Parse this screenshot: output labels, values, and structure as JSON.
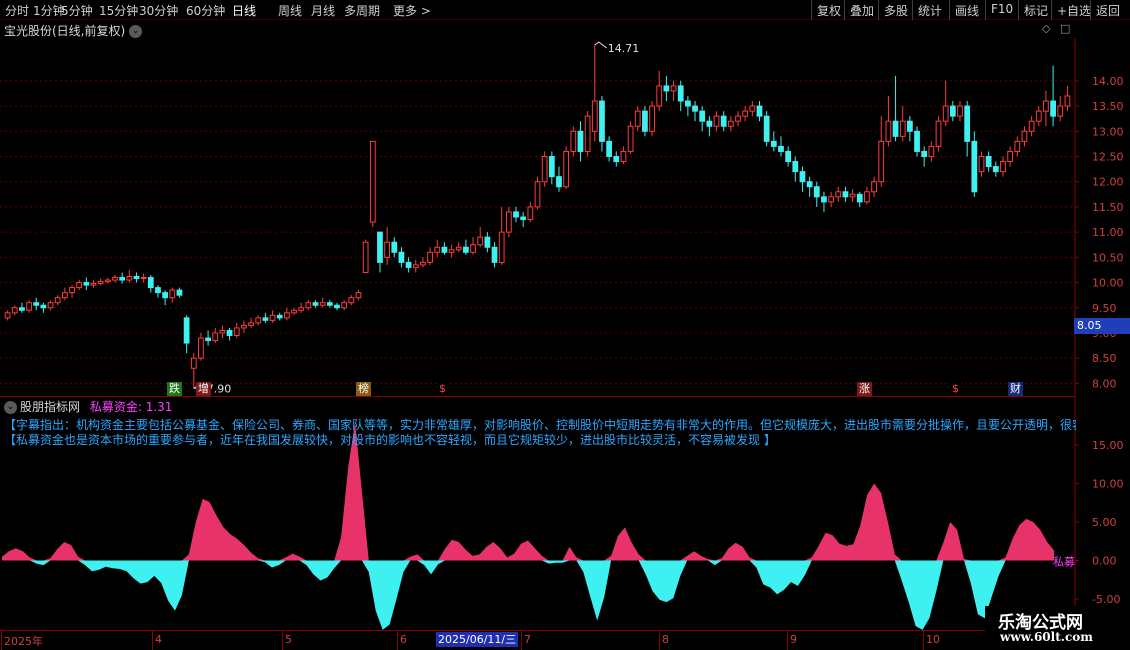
{
  "toolbar": {
    "periods": [
      "分时",
      "1分钟",
      "5分钟",
      "15分钟",
      "30分钟",
      "60分钟",
      "日线",
      "周线",
      "月线",
      "多周期",
      "更多 >"
    ],
    "active_period": "日线",
    "actions": [
      "复权",
      "叠加",
      "多股",
      "统计",
      "画线",
      "F10",
      "标记",
      "+自选",
      "返回"
    ]
  },
  "main_chart": {
    "title": "宝光股份(日线,前复权)",
    "high_marker": "14.71",
    "low_marker": "7.90",
    "current_price": "8.05",
    "y_ticks": [
      "14.00",
      "13.50",
      "13.00",
      "12.50",
      "12.00",
      "11.50",
      "11.00",
      "10.50",
      "10.00",
      "9.50",
      "9.00",
      "8.50",
      "8.00"
    ],
    "event_tags": [
      {
        "text": "跌",
        "color": "#1a7a1a"
      },
      {
        "text": "增",
        "color": "#7a1a1a"
      },
      {
        "text": "榜",
        "color": "#8a5a10"
      },
      {
        "text": "$",
        "color": "#000000"
      },
      {
        "text": "涨",
        "color": "#7a1a1a"
      },
      {
        "text": "$",
        "color": "#000000"
      },
      {
        "text": "财",
        "color": "#1a2a7a"
      }
    ]
  },
  "indicator": {
    "site": "股朋指标网",
    "name_label": "私募资金:",
    "value": "1.31",
    "description_lines": [
      "【字幕指出：机构资金主要包括公募基金、保险公司、券商、国家队等等，实力非常雄厚，对影响股价、控制股价中短期走势有非常大的作用。但它规模庞大，进出股市需要分批操作，且要公开透明，很容",
      "【私募资金也是资本市场的重要参与者，近年在我国发展较快，对股市的影响也不容轻视，而且它规矩较少，进出股市比较灵活，不容易被发现 】"
    ],
    "series_label": "私募",
    "y_ticks": [
      "15.00",
      "10.00",
      "5.00",
      "0.00",
      "-5.00"
    ]
  },
  "chart_data": {
    "type": "area",
    "title": "",
    "xlabel": "",
    "ylabel": "",
    "ylim": [
      -8,
      20
    ],
    "x": [
      1,
      2,
      3,
      4,
      5,
      6,
      7,
      8,
      9,
      10,
      11,
      12,
      13,
      14,
      15,
      16,
      17,
      18,
      19,
      20,
      21,
      22,
      23,
      24,
      25,
      26,
      27,
      28,
      29,
      30,
      31,
      32,
      33,
      34,
      35,
      36,
      37,
      38,
      39,
      40,
      41,
      42,
      43,
      44,
      45,
      46,
      47,
      48,
      49,
      50,
      51,
      52,
      53,
      54,
      55,
      56,
      57,
      58,
      59,
      60,
      61,
      62,
      63,
      64,
      65,
      66,
      67,
      68,
      69,
      70,
      71,
      72,
      73,
      74,
      75,
      76,
      77,
      78,
      79,
      80,
      81,
      82,
      83,
      84,
      85,
      86,
      87,
      88,
      89,
      90,
      91,
      92,
      93,
      94,
      95,
      96,
      97,
      98,
      99,
      100,
      101,
      102,
      103,
      104,
      105,
      106,
      107,
      108,
      109,
      110,
      111,
      112,
      113,
      114,
      115,
      116,
      117,
      118,
      119,
      120,
      121,
      122,
      123,
      124,
      125,
      126,
      127,
      128,
      129,
      130,
      131,
      132,
      133,
      134,
      135,
      136,
      137,
      138,
      139,
      140,
      141,
      142,
      143,
      144,
      145,
      146,
      147,
      148,
      149,
      150,
      151,
      152,
      153,
      154,
      155,
      156,
      157,
      158,
      159,
      160,
      161,
      162,
      163,
      164,
      165,
      166,
      167,
      168,
      169,
      170,
      171,
      172,
      173,
      174,
      175
    ],
    "series": [
      {
        "name": "私募",
        "color_positive": "#e8336a",
        "color_negative": "#3ff0f0",
        "values": [
          0.5,
          1.2,
          1.6,
          1.2,
          0.4,
          -0.4,
          -0.6,
          0.3,
          1.5,
          2.4,
          2.0,
          0.5,
          -0.6,
          -1.4,
          -1.2,
          -0.8,
          -1.0,
          -1.1,
          -1.4,
          -2.3,
          -3.0,
          -2.8,
          -2.0,
          -2.9,
          -5.2,
          -6.5,
          -4.5,
          0.8,
          5.0,
          8.0,
          7.6,
          5.8,
          4.3,
          3.4,
          2.8,
          2.0,
          1.0,
          0.3,
          -0.2,
          -0.9,
          -0.6,
          0.4,
          0.9,
          0.5,
          -0.6,
          -1.8,
          -2.6,
          -2.2,
          -1.0,
          3.0,
          12.0,
          18.0,
          9.0,
          -1.5,
          -6.5,
          -9.0,
          -8.3,
          -5.0,
          -1.5,
          0.5,
          0.8,
          -0.6,
          -1.8,
          -0.5,
          1.5,
          2.7,
          2.4,
          1.4,
          0.6,
          0.8,
          1.8,
          2.4,
          1.6,
          0.4,
          0.9,
          2.2,
          2.6,
          1.6,
          0.6,
          -0.4,
          -0.3,
          -0.3,
          1.8,
          0.4,
          -1.5,
          -4.7,
          -7.8,
          -4.8,
          0.6,
          3.2,
          4.3,
          2.3,
          0.8,
          -1.8,
          -4.0,
          -5.1,
          -5.4,
          -4.9,
          -2.0,
          0.6,
          1.2,
          0.6,
          0.2,
          -0.6,
          0.3,
          1.6,
          2.3,
          1.8,
          0.4,
          -0.9,
          -3.1,
          -3.5,
          -4.4,
          -3.8,
          -2.8,
          -3.3,
          -1.9,
          0.4,
          1.9,
          3.6,
          3.3,
          2.2,
          1.9,
          2.1,
          4.5,
          8.5,
          10.0,
          8.8,
          5.0,
          0.8,
          -2.6,
          -5.4,
          -8.5,
          -9.0,
          -7.5,
          -4.0,
          2.3,
          5.0,
          4.0,
          0.2,
          -3.0,
          -7.0,
          -7.5,
          -4.7,
          -2.0,
          0.4,
          2.8,
          4.6,
          5.4,
          5.0,
          4.0,
          2.4,
          1.31
        ]
      }
    ]
  },
  "price_data": {
    "high_marker_index": 82,
    "low_marker_index": 26,
    "candles": [
      [
        9.3,
        9.4,
        9.25,
        9.45
      ],
      [
        9.4,
        9.5,
        9.35,
        9.55
      ],
      [
        9.5,
        9.45,
        9.4,
        9.6
      ],
      [
        9.45,
        9.6,
        9.4,
        9.65
      ],
      [
        9.6,
        9.55,
        9.45,
        9.7
      ],
      [
        9.55,
        9.5,
        9.4,
        9.6
      ],
      [
        9.5,
        9.6,
        9.45,
        9.65
      ],
      [
        9.6,
        9.7,
        9.55,
        9.75
      ],
      [
        9.7,
        9.8,
        9.65,
        9.9
      ],
      [
        9.8,
        9.9,
        9.7,
        9.95
      ],
      [
        9.9,
        10.0,
        9.85,
        10.05
      ],
      [
        10.0,
        9.95,
        9.85,
        10.1
      ],
      [
        9.95,
        9.98,
        9.9,
        10.05
      ],
      [
        9.98,
        10.02,
        9.95,
        10.08
      ],
      [
        10.02,
        10.05,
        9.98,
        10.1
      ],
      [
        10.05,
        10.1,
        10.0,
        10.15
      ],
      [
        10.1,
        10.05,
        9.98,
        10.2
      ],
      [
        10.05,
        10.12,
        10.0,
        10.25
      ],
      [
        10.12,
        10.08,
        10.0,
        10.2
      ],
      [
        10.08,
        10.1,
        10.0,
        10.18
      ],
      [
        10.1,
        9.9,
        9.8,
        10.15
      ],
      [
        9.9,
        9.8,
        9.7,
        9.95
      ],
      [
        9.8,
        9.7,
        9.55,
        9.85
      ],
      [
        9.7,
        9.85,
        9.6,
        9.9
      ],
      [
        9.85,
        9.75,
        9.7,
        9.9
      ],
      [
        9.3,
        8.8,
        8.6,
        9.35
      ],
      [
        8.3,
        8.5,
        7.9,
        8.6
      ],
      [
        8.5,
        8.9,
        8.45,
        9.0
      ],
      [
        8.9,
        8.85,
        8.75,
        9.05
      ],
      [
        8.85,
        9.0,
        8.8,
        9.1
      ],
      [
        9.0,
        9.05,
        8.9,
        9.15
      ],
      [
        9.05,
        8.95,
        8.85,
        9.1
      ],
      [
        8.95,
        9.1,
        8.9,
        9.2
      ],
      [
        9.1,
        9.15,
        9.0,
        9.25
      ],
      [
        9.15,
        9.2,
        9.1,
        9.3
      ],
      [
        9.2,
        9.3,
        9.15,
        9.35
      ],
      [
        9.3,
        9.25,
        9.2,
        9.4
      ],
      [
        9.25,
        9.35,
        9.2,
        9.45
      ],
      [
        9.35,
        9.3,
        9.25,
        9.4
      ],
      [
        9.3,
        9.4,
        9.25,
        9.5
      ],
      [
        9.4,
        9.45,
        9.35,
        9.5
      ],
      [
        9.45,
        9.5,
        9.4,
        9.6
      ],
      [
        9.5,
        9.6,
        9.45,
        9.65
      ],
      [
        9.6,
        9.55,
        9.5,
        9.65
      ],
      [
        9.55,
        9.6,
        9.5,
        9.7
      ],
      [
        9.6,
        9.55,
        9.5,
        9.65
      ],
      [
        9.55,
        9.5,
        9.45,
        9.6
      ],
      [
        9.5,
        9.6,
        9.45,
        9.65
      ],
      [
        9.6,
        9.7,
        9.55,
        9.75
      ],
      [
        9.7,
        9.8,
        9.65,
        9.85
      ],
      [
        10.2,
        10.8,
        10.2,
        10.85
      ],
      [
        11.2,
        12.8,
        11.1,
        12.8
      ],
      [
        11.0,
        10.4,
        10.2,
        11.0
      ],
      [
        10.5,
        10.8,
        10.35,
        11.1
      ],
      [
        10.8,
        10.6,
        10.5,
        10.9
      ],
      [
        10.6,
        10.4,
        10.3,
        10.7
      ],
      [
        10.4,
        10.3,
        10.2,
        10.5
      ],
      [
        10.3,
        10.35,
        10.2,
        10.45
      ],
      [
        10.35,
        10.4,
        10.3,
        10.5
      ],
      [
        10.4,
        10.6,
        10.35,
        10.7
      ],
      [
        10.6,
        10.7,
        10.5,
        10.85
      ],
      [
        10.7,
        10.6,
        10.55,
        10.8
      ],
      [
        10.6,
        10.65,
        10.5,
        10.75
      ],
      [
        10.65,
        10.7,
        10.6,
        10.8
      ],
      [
        10.7,
        10.6,
        10.55,
        10.85
      ],
      [
        10.6,
        10.75,
        10.55,
        10.9
      ],
      [
        10.75,
        10.9,
        10.7,
        11.1
      ],
      [
        10.9,
        10.7,
        10.6,
        11.0
      ],
      [
        10.7,
        10.4,
        10.3,
        10.8
      ],
      [
        10.4,
        11.0,
        10.35,
        11.5
      ],
      [
        11.0,
        11.4,
        10.9,
        11.5
      ],
      [
        11.4,
        11.3,
        11.2,
        11.5
      ],
      [
        11.3,
        11.25,
        11.1,
        11.4
      ],
      [
        11.25,
        11.5,
        11.2,
        11.6
      ],
      [
        11.5,
        12.0,
        11.45,
        12.1
      ],
      [
        12.0,
        12.5,
        11.9,
        12.6
      ],
      [
        12.5,
        12.1,
        11.95,
        12.6
      ],
      [
        12.1,
        11.9,
        11.8,
        12.3
      ],
      [
        11.9,
        12.6,
        11.85,
        12.7
      ],
      [
        12.6,
        13.0,
        12.5,
        13.1
      ],
      [
        13.0,
        12.6,
        12.4,
        13.2
      ],
      [
        12.6,
        13.3,
        12.5,
        13.4
      ],
      [
        13.0,
        13.6,
        12.8,
        14.71
      ],
      [
        13.6,
        12.8,
        12.6,
        13.7
      ],
      [
        12.8,
        12.5,
        12.4,
        12.9
      ],
      [
        12.5,
        12.4,
        12.3,
        12.6
      ],
      [
        12.4,
        12.6,
        12.35,
        12.7
      ],
      [
        12.6,
        13.1,
        12.55,
        13.2
      ],
      [
        13.1,
        13.4,
        13.0,
        13.5
      ],
      [
        13.4,
        13.0,
        12.9,
        13.5
      ],
      [
        13.0,
        13.5,
        12.9,
        13.6
      ],
      [
        13.5,
        13.9,
        13.4,
        14.2
      ],
      [
        13.9,
        13.8,
        13.6,
        14.1
      ],
      [
        13.8,
        13.9,
        13.6,
        14.0
      ],
      [
        13.9,
        13.6,
        13.4,
        14.0
      ],
      [
        13.6,
        13.5,
        13.3,
        13.7
      ],
      [
        13.5,
        13.4,
        13.2,
        13.6
      ],
      [
        13.4,
        13.2,
        13.0,
        13.5
      ],
      [
        13.2,
        13.1,
        12.9,
        13.3
      ],
      [
        13.1,
        13.3,
        13.0,
        13.4
      ],
      [
        13.3,
        13.1,
        13.0,
        13.4
      ],
      [
        13.1,
        13.2,
        13.0,
        13.3
      ],
      [
        13.2,
        13.3,
        13.1,
        13.4
      ],
      [
        13.3,
        13.4,
        13.2,
        13.5
      ],
      [
        13.4,
        13.5,
        13.3,
        13.6
      ],
      [
        13.5,
        13.3,
        13.2,
        13.6
      ],
      [
        13.3,
        12.8,
        12.7,
        13.4
      ],
      [
        12.8,
        12.7,
        12.6,
        13.0
      ],
      [
        12.7,
        12.6,
        12.5,
        12.9
      ],
      [
        12.6,
        12.4,
        12.3,
        12.7
      ],
      [
        12.4,
        12.2,
        12.0,
        12.5
      ],
      [
        12.2,
        12.0,
        11.8,
        12.3
      ],
      [
        12.0,
        11.9,
        11.7,
        12.1
      ],
      [
        11.9,
        11.7,
        11.5,
        12.0
      ],
      [
        11.7,
        11.6,
        11.4,
        11.8
      ],
      [
        11.6,
        11.7,
        11.5,
        11.8
      ],
      [
        11.7,
        11.8,
        11.6,
        11.9
      ],
      [
        11.8,
        11.7,
        11.6,
        11.9
      ],
      [
        11.7,
        11.75,
        11.6,
        11.85
      ],
      [
        11.75,
        11.6,
        11.5,
        11.8
      ],
      [
        11.6,
        11.8,
        11.55,
        11.9
      ],
      [
        11.8,
        12.0,
        11.7,
        12.1
      ],
      [
        12.0,
        12.8,
        11.9,
        13.3
      ],
      [
        12.8,
        13.2,
        12.7,
        13.7
      ],
      [
        13.2,
        12.9,
        12.8,
        14.1
      ],
      [
        12.9,
        13.2,
        12.8,
        13.5
      ],
      [
        13.2,
        13.0,
        12.8,
        13.3
      ],
      [
        13.0,
        12.6,
        12.5,
        13.1
      ],
      [
        12.6,
        12.5,
        12.3,
        12.7
      ],
      [
        12.5,
        12.7,
        12.4,
        12.8
      ],
      [
        12.7,
        13.2,
        12.6,
        13.3
      ],
      [
        13.2,
        13.5,
        13.1,
        14.0
      ],
      [
        13.5,
        13.3,
        13.2,
        13.6
      ],
      [
        13.3,
        13.5,
        13.2,
        13.6
      ],
      [
        13.5,
        12.8,
        12.5,
        13.6
      ],
      [
        12.8,
        11.8,
        11.7,
        13.0
      ],
      [
        12.2,
        12.5,
        12.1,
        12.6
      ],
      [
        12.5,
        12.3,
        12.2,
        12.6
      ],
      [
        12.3,
        12.2,
        12.1,
        12.4
      ],
      [
        12.2,
        12.4,
        12.1,
        12.5
      ],
      [
        12.4,
        12.6,
        12.3,
        12.7
      ],
      [
        12.6,
        12.8,
        12.5,
        12.9
      ],
      [
        12.8,
        13.0,
        12.7,
        13.1
      ],
      [
        13.0,
        13.2,
        12.9,
        13.3
      ],
      [
        13.2,
        13.4,
        13.1,
        13.5
      ],
      [
        13.4,
        13.6,
        13.1,
        13.8
      ],
      [
        13.6,
        13.3,
        13.1,
        14.3
      ],
      [
        13.3,
        13.5,
        13.2,
        13.7
      ],
      [
        13.5,
        13.7,
        13.4,
        13.9
      ]
    ]
  },
  "date_axis": {
    "labels": [
      "2025年",
      "4",
      "5",
      "6",
      "2025/06/11/三",
      "7",
      "8",
      "9",
      "10"
    ],
    "highlighted": "2025/06/11/三"
  },
  "watermark": {
    "line1": "乐淘公式网",
    "line2": "www.60lt.com"
  }
}
